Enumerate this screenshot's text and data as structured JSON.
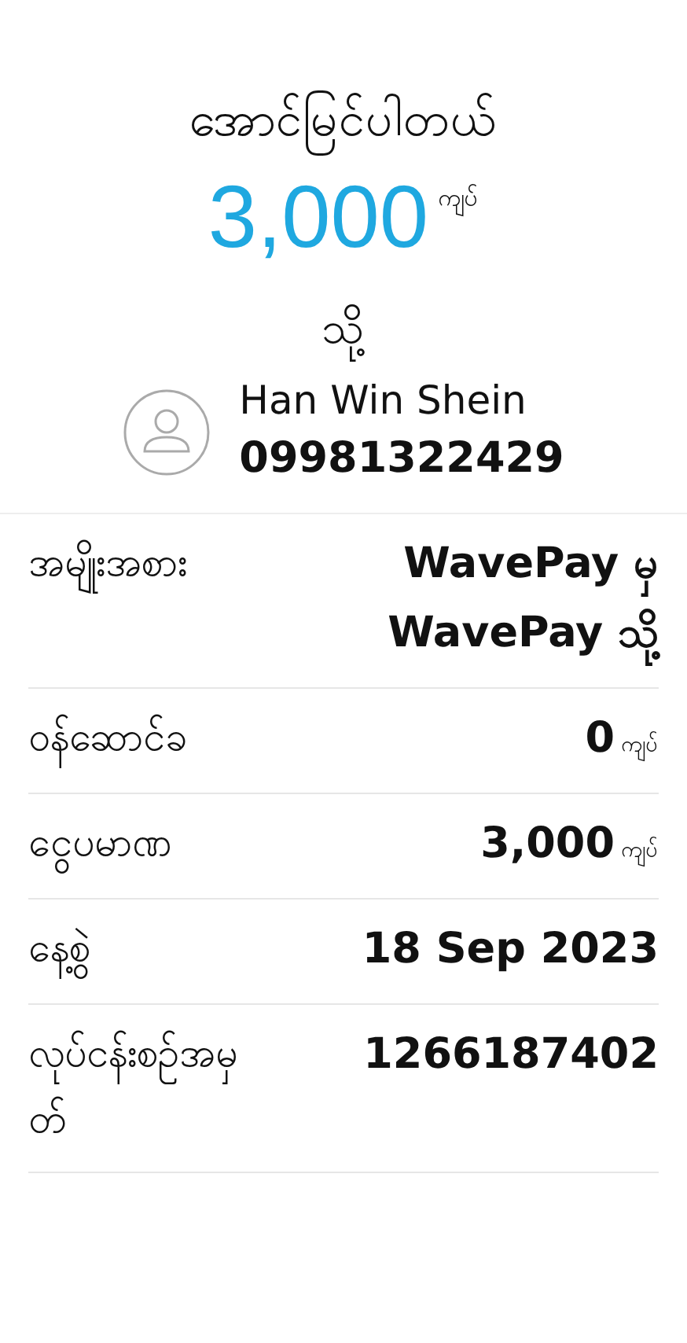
{
  "header": {
    "status": "အောင်မြင်ပါတယ်",
    "amount": "3,000",
    "currency": "ကျပ်",
    "to_label": "သို့"
  },
  "recipient": {
    "name": "Han Win Shein",
    "phone": "09981322429"
  },
  "details": [
    {
      "label": "အမျိုးအစား",
      "lines": [
        "WavePay မှ",
        "WavePay သို့"
      ]
    },
    {
      "label": "ဝန်ဆောင်ခ",
      "lines": [
        "0"
      ],
      "unit": "ကျပ်"
    },
    {
      "label": "ငွေပမာဏ",
      "lines": [
        "3,000"
      ],
      "unit": "ကျပ်"
    },
    {
      "label": "နေ့စွဲ",
      "lines": [
        "18 Sep 2023"
      ]
    },
    {
      "label": "လုပ်ငန်းစဉ်အမှတ်",
      "lines": [
        "1266187402"
      ]
    }
  ]
}
